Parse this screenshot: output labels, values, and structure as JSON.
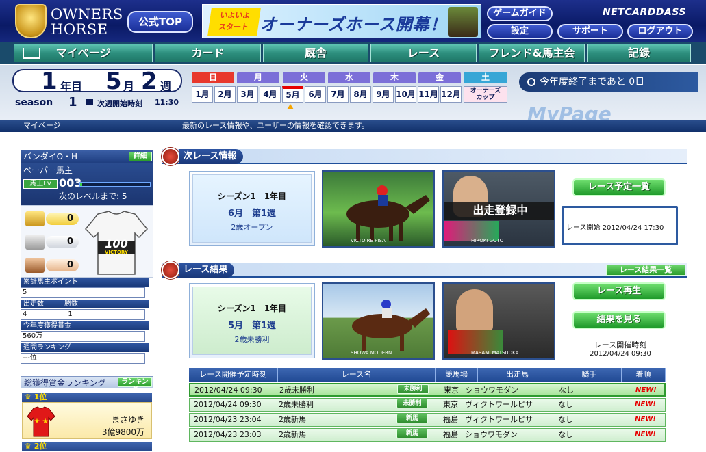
{
  "header": {
    "logo_line1": "OWNERS",
    "logo_line2": "HORSE",
    "official_top": "公式TOP",
    "banner_tag": "いよいよ\nスタート",
    "banner_text": "オーナーズホース開幕！",
    "brand": "NETCARDDASS",
    "buttons": {
      "game_guide": "ゲームガイド",
      "settings": "設定",
      "support": "サポート",
      "logout": "ログアウト"
    }
  },
  "nav": [
    {
      "label": "マイページ"
    },
    {
      "label": "カード"
    },
    {
      "label": "厩舎"
    },
    {
      "label": "レース"
    },
    {
      "label": "フレンド&馬主会"
    },
    {
      "label": "記録"
    }
  ],
  "calendar": {
    "year_num": "1",
    "year_unit": "年目",
    "month_num": "5",
    "month_unit": "月",
    "week_num": "2",
    "week_unit": "週",
    "season_label": "season",
    "season_num": "1",
    "next_week_label": "次週開始時刻",
    "next_week_time": "11:30",
    "days": [
      "日",
      "月",
      "火",
      "水",
      "木",
      "金",
      "土"
    ],
    "months": [
      "1月",
      "2月",
      "3月",
      "4月",
      "5月",
      "6月",
      "7月",
      "8月",
      "9月",
      "10月",
      "11月",
      "12月"
    ],
    "last_cell": "オーナーズ\nカップ",
    "current_month_index": 4,
    "end_of_year": "今年度終了まであと 0日",
    "watermark": "MyPage"
  },
  "breadcrumb": {
    "title": "マイページ",
    "description": "最新のレース情報や、ユーザーの情報を確認できます。"
  },
  "sidebar": {
    "owner_name": "バンダイO・H",
    "detail_button": "詳細",
    "rank_title": "ペーパー馬主",
    "level_label": "馬主Lv",
    "level_value": "003",
    "next_level_text": "次のレベルまで: 5",
    "trophies": [
      {
        "label": "GI",
        "count": "0"
      },
      {
        "label": "GII",
        "count": "0"
      },
      {
        "label": "GIII",
        "count": "0"
      }
    ],
    "silks_number": "100",
    "silks_text": "VICTORY",
    "stats": [
      {
        "label": "累計馬主ポイント",
        "value": "5"
      },
      {
        "label": "出走数　　　勝数",
        "value": "4　　　　　　1"
      },
      {
        "label": "今年度獲得賞金",
        "value": "560万"
      },
      {
        "label": "週間ランキング",
        "value": "---位"
      }
    ],
    "ranking_title": "総獲得賞金ランキング",
    "ranking_button": "ランキング",
    "ranking": [
      {
        "rank": "1位",
        "name": "まさゆき",
        "amount": "3億9800万"
      },
      {
        "rank": "2位"
      }
    ]
  },
  "next_race": {
    "section_title": "次レース情報",
    "season": "シーズン1　1年目",
    "month_week": "6月　第1週",
    "race_name": "2歳オープン",
    "card1_caption": "VICTOIRE PISA",
    "card2_banner": "出走登録中",
    "card2_caption": "HIROKI GOTO",
    "schedule_button": "レース予定一覧",
    "start_label": "レース開始",
    "start_time": "2012/04/24 17:30"
  },
  "race_result": {
    "section_title": "レース結果",
    "list_button": "レース結果一覧",
    "season": "シーズン1　1年目",
    "month_week": "5月　第1週",
    "race_name": "2歳未勝利",
    "card1_caption": "SHOWA MODERN",
    "card2_caption": "MASAMI MATSUOKA",
    "replay_button": "レース再生",
    "result_button": "結果を見る",
    "held_label": "レース開催時刻",
    "held_time": "2012/04/24 09:30"
  },
  "table": {
    "headers": [
      "レース開催予定時刻",
      "レース名",
      "競馬場",
      "出走馬",
      "騎手",
      "着順"
    ],
    "rows": [
      {
        "time": "2012/04/24 09:30",
        "race": "2歳未勝利",
        "badge": "未勝利",
        "course": "東京",
        "horse": "ショウワモダン",
        "jockey": "なし",
        "result": "NEW!"
      },
      {
        "time": "2012/04/24 09:30",
        "race": "2歳未勝利",
        "badge": "未勝利",
        "course": "東京",
        "horse": "ヴィクトワールピサ",
        "jockey": "なし",
        "result": "NEW!"
      },
      {
        "time": "2012/04/23 23:04",
        "race": "2歳新馬",
        "badge": "新馬",
        "course": "福島",
        "horse": "ヴィクトワールピサ",
        "jockey": "なし",
        "result": "NEW!"
      },
      {
        "time": "2012/04/23 23:03",
        "race": "2歳新馬",
        "badge": "新馬",
        "course": "福島",
        "horse": "ショウワモダン",
        "jockey": "なし",
        "result": "NEW!"
      }
    ]
  },
  "colors": {
    "sunday": "#e8382c",
    "weekday": "#7b6fd8",
    "saturday": "#36a6d6",
    "accent_green": "#2b9d2b",
    "nav_teal": "#2d8f7e"
  }
}
